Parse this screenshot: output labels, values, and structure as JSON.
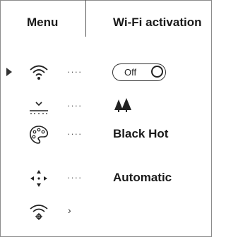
{
  "header": {
    "menu_label": "Menu",
    "title": "Wi-Fi activation"
  },
  "rows": [
    {
      "icon": "wifi-icon",
      "dots": "····",
      "value_type": "toggle",
      "toggle": {
        "label": "Off",
        "state": "off"
      }
    },
    {
      "icon": "calibration-icon",
      "dots": "····",
      "value_type": "icon",
      "value_icon": "trees-icon"
    },
    {
      "icon": "palette-icon",
      "dots": "····",
      "value_type": "text",
      "value": "Black Hot"
    },
    {
      "icon": "auto-calibration-icon",
      "dots": "····",
      "value_type": "text",
      "value": "Automatic"
    },
    {
      "icon": "wifi-settings-icon",
      "chevron": "›"
    }
  ],
  "colors": {
    "text": "#1a1a1a",
    "border": "#8c8c8c"
  }
}
